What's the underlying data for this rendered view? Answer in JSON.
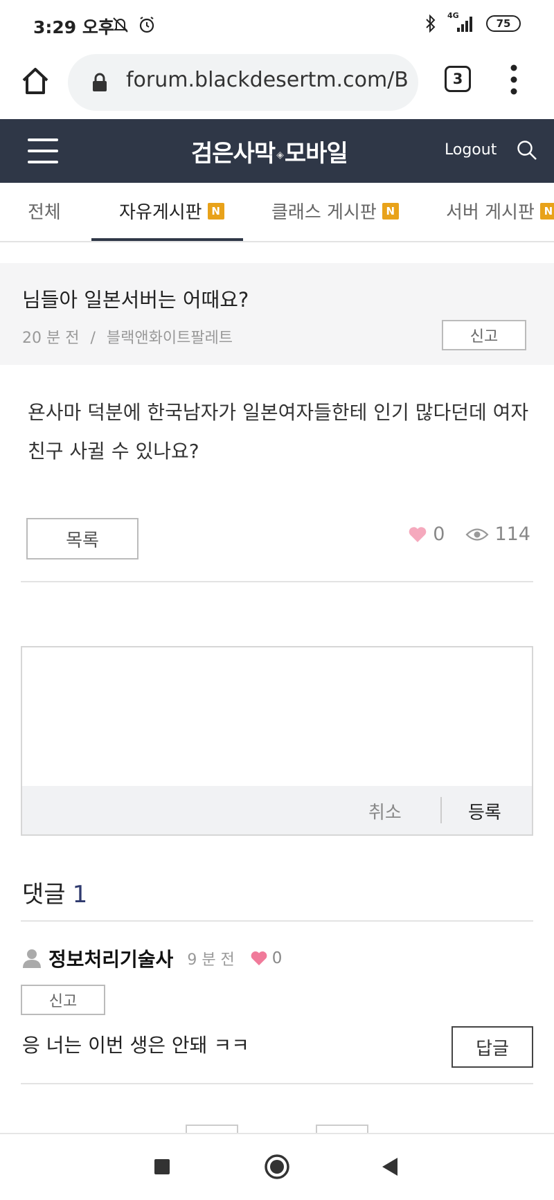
{
  "status_bar": {
    "time": "3:29 오후",
    "network": "4G",
    "battery": "75",
    "icons": [
      "mute-icon",
      "alarm-icon",
      "bluetooth-icon",
      "signal-icon",
      "battery-icon"
    ]
  },
  "browser": {
    "url": "forum.blackdesertm.com/B",
    "tab_count": "3",
    "icons": [
      "home-icon",
      "lock-icon",
      "tabs-icon",
      "more-vertical-icon"
    ]
  },
  "site_header": {
    "logo_left": "검은사막",
    "logo_right": "모바일",
    "logout_label": "Logout",
    "icons": [
      "menu-icon",
      "search-icon"
    ],
    "background": "#2f3747"
  },
  "tabs": [
    {
      "label": "전체",
      "badge": ""
    },
    {
      "label": "자유게시판",
      "badge": "N",
      "active": true
    },
    {
      "label": "클래스 게시판",
      "badge": "N"
    },
    {
      "label": "서버 게시판",
      "badge": "N"
    }
  ],
  "post": {
    "title": "님들아 일본서버는 어때요?",
    "time_ago": "20 분 전",
    "meta_separator": "/",
    "author": "블랙앤화이트팔레트",
    "report_label": "신고",
    "body": "욘사마 덕분에 한국남자가 일본여자들한테 인기 많다던데 여자친구 사귈 수 있나요?",
    "list_button": "목록",
    "likes": "0",
    "views": "114"
  },
  "comment_editor": {
    "placeholder": "",
    "cancel_label": "취소",
    "submit_label": "등록"
  },
  "comments": {
    "title": "댓글",
    "count": "1",
    "items": [
      {
        "author": "정보처리기술사",
        "time_ago": "9 분 전",
        "likes": "0",
        "report_label": "신고",
        "text": "응 너는 이번 생은 안돼 ㅋㅋ",
        "reply_label": "답글"
      }
    ]
  },
  "colors": {
    "accent_dark": "#2f3747",
    "badge": "#e8a21a",
    "heart": "#f07a9a",
    "count_blue": "#2f3a6e"
  }
}
